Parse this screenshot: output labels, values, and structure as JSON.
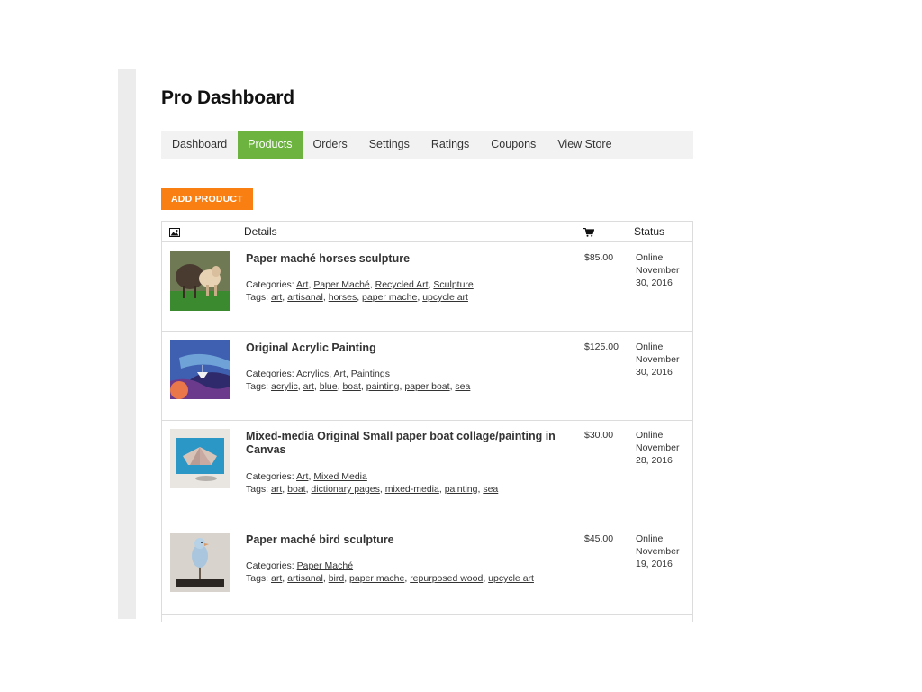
{
  "page_title": "Pro Dashboard",
  "tabs": [
    {
      "label": "Dashboard",
      "active": false
    },
    {
      "label": "Products",
      "active": true
    },
    {
      "label": "Orders",
      "active": false
    },
    {
      "label": "Settings",
      "active": false
    },
    {
      "label": "Ratings",
      "active": false
    },
    {
      "label": "Coupons",
      "active": false
    },
    {
      "label": "View Store",
      "active": false
    }
  ],
  "add_button": "ADD PRODUCT",
  "table": {
    "headers": {
      "image_icon": "image-icon",
      "details": "Details",
      "cart_icon": "cart-icon",
      "status": "Status"
    },
    "rows": [
      {
        "name": "Paper maché horses sculpture",
        "categories_label": "Categories:",
        "categories": [
          "Art",
          "Paper Maché",
          "Recycled Art",
          "Sculpture"
        ],
        "tags_label": "Tags:",
        "tags": [
          "art",
          "artisanal",
          "horses",
          "paper mache",
          "upcycle art"
        ],
        "price": "$85.00",
        "status": [
          "Online",
          "November",
          "30, 2016"
        ]
      },
      {
        "name": "Original Acrylic Painting",
        "categories_label": "Categories:",
        "categories": [
          "Acrylics",
          "Art",
          "Paintings"
        ],
        "tags_label": "Tags:",
        "tags": [
          "acrylic",
          "art",
          "blue",
          "boat",
          "painting",
          "paper boat",
          "sea"
        ],
        "price": "$125.00",
        "status": [
          "Online",
          "November",
          "30, 2016"
        ]
      },
      {
        "name": "Mixed-media Original Small paper boat collage/painting in Canvas",
        "categories_label": "Categories:",
        "categories": [
          "Art",
          "Mixed Media"
        ],
        "tags_label": "Tags:",
        "tags": [
          "art",
          "boat",
          "dictionary pages",
          "mixed-media",
          "painting",
          "sea"
        ],
        "price": "$30.00",
        "status": [
          "Online",
          "November",
          "28, 2016"
        ]
      },
      {
        "name": "Paper maché bird sculpture",
        "categories_label": "Categories:",
        "categories": [
          "Paper Maché"
        ],
        "tags_label": "Tags:",
        "tags": [
          "art",
          "artisanal",
          "bird",
          "paper mache",
          "repurposed wood",
          "upcycle art"
        ],
        "price": "$45.00",
        "status": [
          "Online",
          "November",
          "19, 2016"
        ]
      }
    ]
  },
  "colors": {
    "active_tab": "#6cb33f",
    "add_button": "#f97f13"
  }
}
